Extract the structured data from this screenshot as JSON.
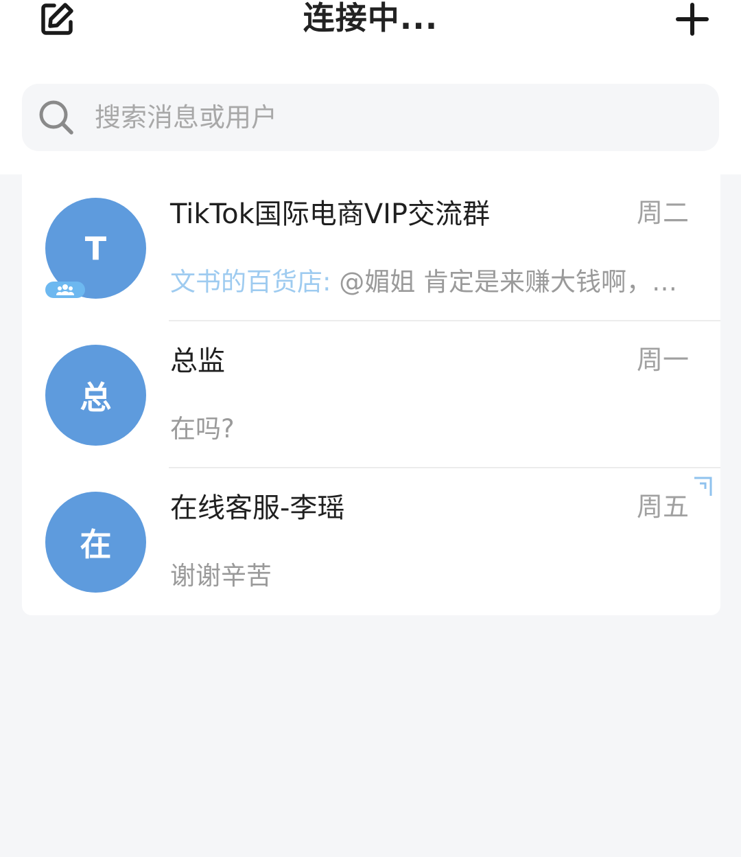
{
  "header": {
    "title": "连接中...",
    "edit_icon": "edit-icon",
    "add_icon": "plus-icon"
  },
  "search": {
    "placeholder": "搜索消息或用户",
    "icon": "search-icon"
  },
  "colors": {
    "avatar": "#5e9bdd",
    "group_badge": "#6db8f0",
    "sender_highlight": "#9ecbf0"
  },
  "chats": [
    {
      "avatar_letter": "T",
      "name": "TikTok国际电商VIP交流群",
      "time": "周二",
      "sender": "文书的百货店:",
      "message": " @媚姐 肯定是来赚大钱啊，…",
      "is_group": true
    },
    {
      "avatar_letter": "总",
      "name": "总监",
      "time": "周一",
      "message": "在吗?"
    },
    {
      "avatar_letter": "在",
      "name": "在线客服-李瑶",
      "time": "周五",
      "message": "谢谢辛苦"
    }
  ]
}
